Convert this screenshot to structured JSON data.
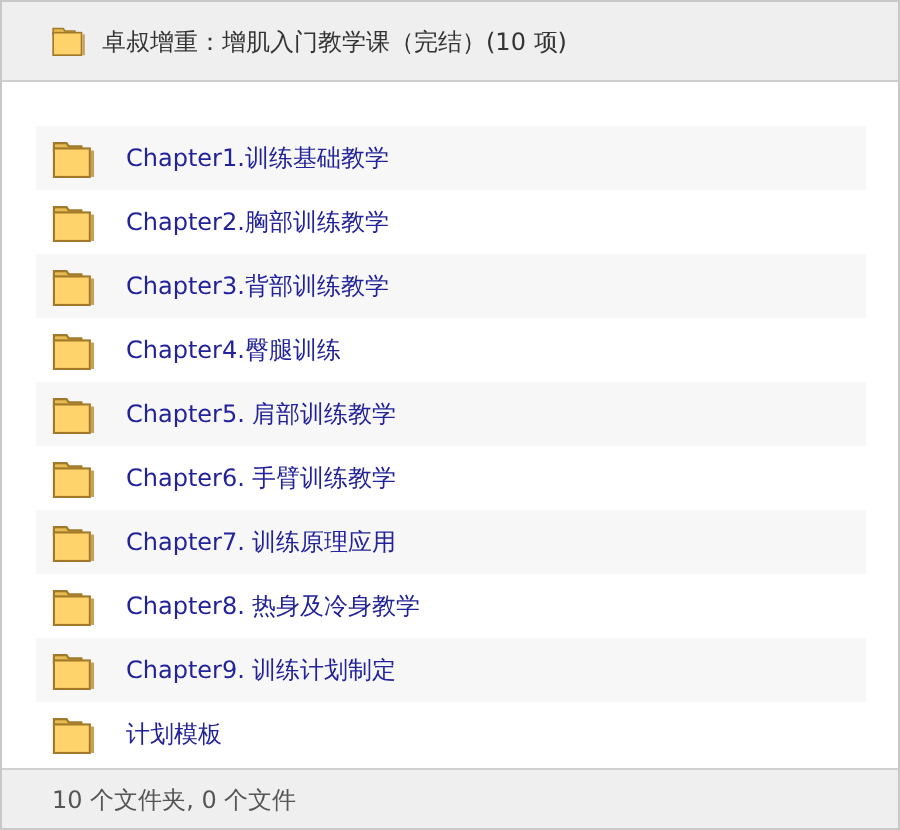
{
  "header": {
    "title": "卓叔增重：增肌入门教学课（完结）(10 项)"
  },
  "folders": [
    {
      "name": "Chapter1.训练基础教学"
    },
    {
      "name": "Chapter2.胸部训练教学"
    },
    {
      "name": "Chapter3.背部训练教学"
    },
    {
      "name": "Chapter4.臀腿训练"
    },
    {
      "name": "Chapter5. 肩部训练教学"
    },
    {
      "name": "Chapter6. 手臂训练教学"
    },
    {
      "name": "Chapter7. 训练原理应用"
    },
    {
      "name": "Chapter8. 热身及冷身教学"
    },
    {
      "name": "Chapter9. 训练计划制定"
    },
    {
      "name": "计划模板"
    }
  ],
  "status_bar": "10 个文件夹, 0 个文件"
}
